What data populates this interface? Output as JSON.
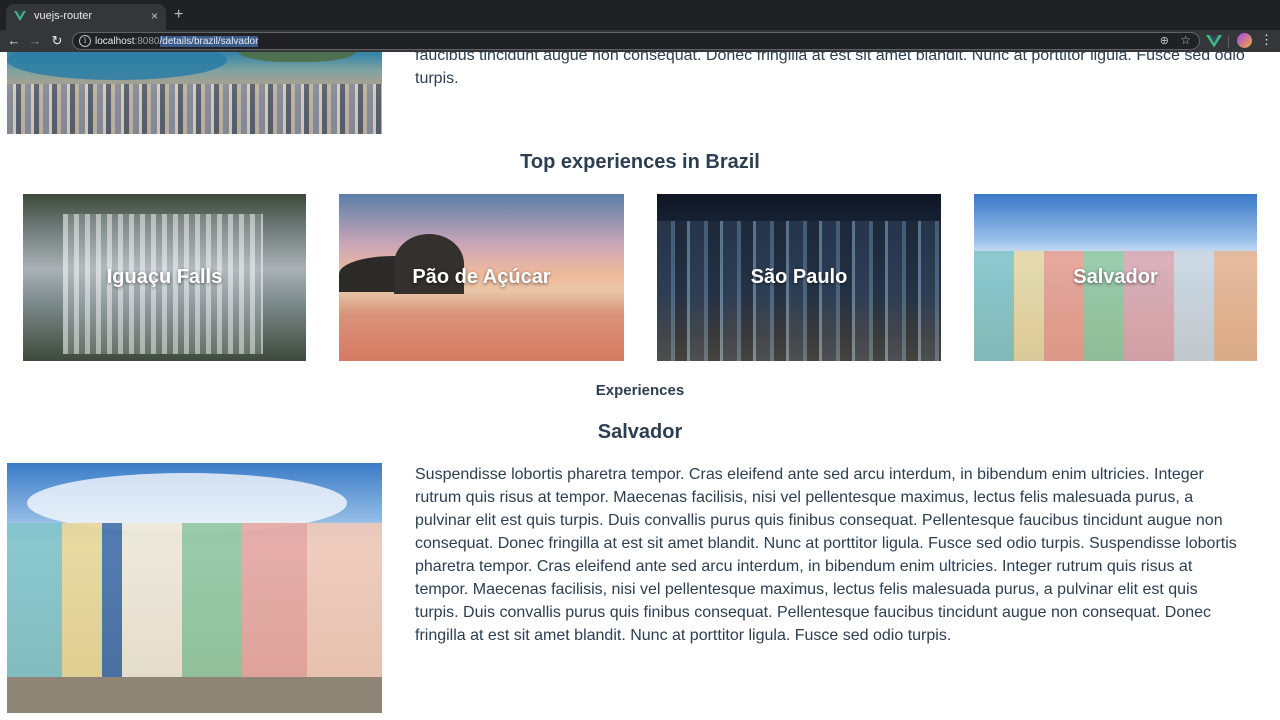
{
  "browser": {
    "tab_title": "vuejs-router",
    "tab_close": "×",
    "new_tab": "+",
    "url_host": "localhost",
    "url_port": ":8080",
    "url_path": "/details/brazil/salvador"
  },
  "icons": {
    "back": "←",
    "forward": "→",
    "reload": "↻",
    "info": "i",
    "zoom": "⊕",
    "star": "☆",
    "menu": "⋮"
  },
  "page": {
    "top_text": "faucibus tincidunt augue non consequat. Donec fringilla at est sit amet blandit. Nunc at porttitor ligula. Fusce sed odio turpis.",
    "top_experiences_title": "Top experiences in Brazil",
    "cards": [
      {
        "label": "Iguaçu Falls"
      },
      {
        "label": "Pão de Açúcar"
      },
      {
        "label": "São Paulo"
      },
      {
        "label": "Salvador"
      }
    ],
    "experiences_heading": "Experiences",
    "destination_title": "Salvador",
    "destination_text": "Suspendisse lobortis pharetra tempor. Cras eleifend ante sed arcu interdum, in bibendum enim ultricies. Integer rutrum quis risus at tempor. Maecenas facilisis, nisi vel pellentesque maximus, lectus felis malesuada purus, a pulvinar elit est quis turpis. Duis convallis purus quis finibus consequat. Pellentesque faucibus tincidunt augue non consequat. Donec fringilla at est sit amet blandit. Nunc at porttitor ligula. Fusce sed odio turpis. Suspendisse lobortis pharetra tempor. Cras eleifend ante sed arcu interdum, in bibendum enim ultricies. Integer rutrum quis risus at tempor. Maecenas facilisis, nisi vel pellentesque maximus, lectus felis malesuada purus, a pulvinar elit est quis turpis. Duis convallis purus quis finibus consequat. Pellentesque faucibus tincidunt augue non consequat. Donec fringilla at est sit amet blandit. Nunc at porttitor ligula. Fusce sed odio turpis."
  },
  "colors": {
    "text": "#2c3e50",
    "vue_green": "#41b883",
    "vue_dark": "#35495e",
    "chrome_dark": "#202124"
  }
}
